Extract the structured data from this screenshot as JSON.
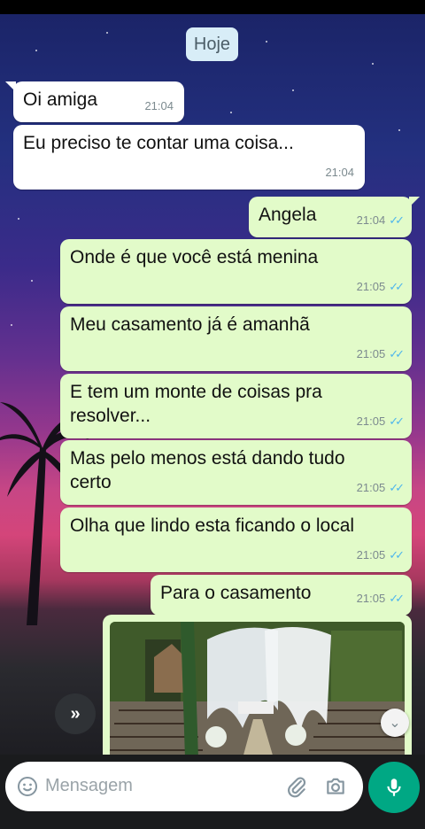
{
  "date_chip": "Hoje",
  "messages": [
    {
      "text": "Oi amiga",
      "time": "21:04"
    },
    {
      "text": "Eu preciso te contar uma coisa...",
      "time": "21:04"
    },
    {
      "text": "Angela",
      "time": "21:04"
    },
    {
      "text": "Onde é que você está menina",
      "time": "21:05"
    },
    {
      "text": "Meu casamento já é amanhã",
      "time": "21:05"
    },
    {
      "text": "E tem um monte de coisas pra resolver...",
      "time": "21:05"
    },
    {
      "text": "Mas pelo menos está dando tudo certo",
      "time": "21:05"
    },
    {
      "text": "Olha que lindo esta ficando o local",
      "time": "21:05"
    },
    {
      "text": "Para o casamento",
      "time": "21:05"
    }
  ],
  "input": {
    "placeholder": "Mensagem"
  },
  "icons": {
    "emoji": "emoji-icon",
    "attach": "paperclip-icon",
    "camera": "camera-icon",
    "mic": "microphone-icon",
    "forward": "forward-icon",
    "scroll": "scroll-down-icon",
    "read_receipt": "double-check-icon"
  },
  "colors": {
    "incoming_bubble": "#ffffff",
    "outgoing_bubble": "#e2fbc9",
    "read_tick": "#4fb6ec",
    "mic_button": "#00a884"
  }
}
